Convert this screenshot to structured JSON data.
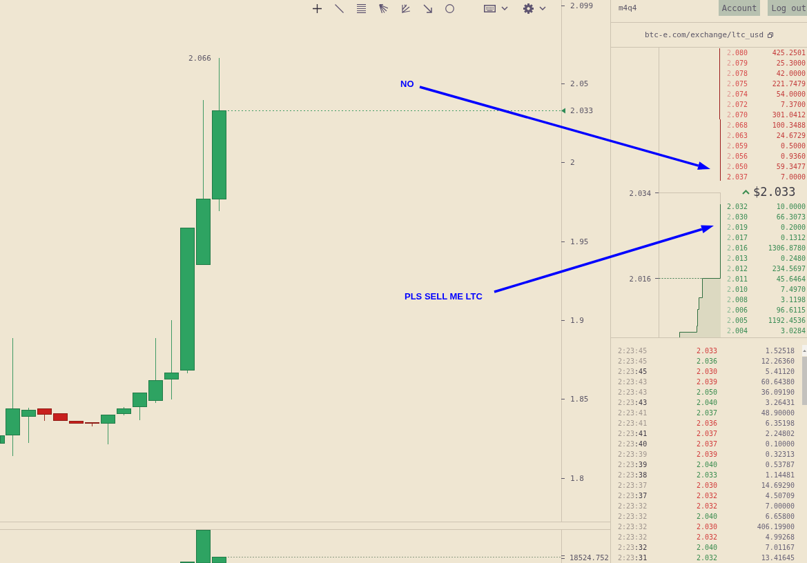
{
  "price_chart": {
    "high_label": "2.066",
    "axis_labels": [
      "2.099",
      "2.05",
      "2",
      "1.95",
      "1.9",
      "1.85",
      "1.8"
    ],
    "last_price_label": "2.033"
  },
  "volume_chart": {
    "axis_label": "18524.752"
  },
  "annotations": [
    {
      "text": "NO"
    },
    {
      "text": "PLS SELL ME LTC"
    }
  ],
  "header": {
    "username": "m4q4",
    "buttons": [
      "Account",
      "Log out"
    ]
  },
  "market_link": "btc-e.com/exchange/ltc_usd",
  "depth_chart": {
    "axis_labels": [
      "2.034",
      "2.016"
    ]
  },
  "asks": [
    {
      "price": "2.080",
      "amount": "425.2501",
      "best": false
    },
    {
      "price": "2.079",
      "amount": "25.3000",
      "best": false
    },
    {
      "price": "2.078",
      "amount": "42.0000",
      "best": false
    },
    {
      "price": "2.075",
      "amount": "221.7479",
      "best": false
    },
    {
      "price": "2.074",
      "amount": "54.0000",
      "best": false
    },
    {
      "price": "2.072",
      "amount": "7.3700",
      "best": false
    },
    {
      "price": "2.070",
      "amount": "301.0412",
      "best": false
    },
    {
      "price": "2.068",
      "amount": "100.3488",
      "best": false
    },
    {
      "price": "2.063",
      "amount": "24.6729",
      "best": false
    },
    {
      "price": "2.059",
      "amount": "0.5000",
      "best": false
    },
    {
      "price": "2.056",
      "amount": "0.9360",
      "best": false
    },
    {
      "price": "2.050",
      "amount": "59.3477",
      "best": false
    },
    {
      "price": "2.037",
      "amount": "7.0000",
      "best": true
    }
  ],
  "last_price": {
    "value": "$2.033",
    "rising": true
  },
  "bids": [
    {
      "price": "2.032",
      "amount": "10.0000",
      "best": true
    },
    {
      "price": "2.030",
      "amount": "66.3073",
      "best": false
    },
    {
      "price": "2.019",
      "amount": "0.2000",
      "best": false
    },
    {
      "price": "2.017",
      "amount": "0.1312",
      "best": false
    },
    {
      "price": "2.016",
      "amount": "1306.8780",
      "best": false
    },
    {
      "price": "2.013",
      "amount": "0.2480",
      "best": false
    },
    {
      "price": "2.012",
      "amount": "234.5697",
      "best": false
    },
    {
      "price": "2.011",
      "amount": "45.6464",
      "best": false
    },
    {
      "price": "2.010",
      "amount": "7.4970",
      "best": false
    },
    {
      "price": "2.008",
      "amount": "3.1198",
      "best": false
    },
    {
      "price": "2.006",
      "amount": "96.6115",
      "best": false
    },
    {
      "price": "2.005",
      "amount": "1192.4536",
      "best": false
    },
    {
      "price": "2.004",
      "amount": "3.0284",
      "best": false
    }
  ],
  "trades": [
    {
      "time": "2:23:45",
      "seconds_highlighted": false,
      "price": "2.033",
      "color": "#d23c3c",
      "amount": "1.52518"
    },
    {
      "time": "2:23:45",
      "seconds_highlighted": false,
      "price": "2.036",
      "color": "#3a8c4f",
      "amount": "12.26360"
    },
    {
      "time": "2:23:45",
      "seconds_highlighted": true,
      "price": "2.030",
      "color": "#d23c3c",
      "amount": "5.41120"
    },
    {
      "time": "2:23:43",
      "seconds_highlighted": false,
      "price": "2.039",
      "color": "#d23c3c",
      "amount": "60.64380"
    },
    {
      "time": "2:23:43",
      "seconds_highlighted": false,
      "price": "2.050",
      "color": "#3a8c4f",
      "amount": "36.09190"
    },
    {
      "time": "2:23:43",
      "seconds_highlighted": true,
      "price": "2.040",
      "color": "#3a8c4f",
      "amount": "3.26431"
    },
    {
      "time": "2:23:41",
      "seconds_highlighted": false,
      "price": "2.037",
      "color": "#3a8c4f",
      "amount": "48.90000"
    },
    {
      "time": "2:23:41",
      "seconds_highlighted": false,
      "price": "2.036",
      "color": "#d23c3c",
      "amount": "6.35198"
    },
    {
      "time": "2:23:41",
      "seconds_highlighted": true,
      "price": "2.037",
      "color": "#d23c3c",
      "amount": "2.24802"
    },
    {
      "time": "2:23:40",
      "seconds_highlighted": true,
      "price": "2.037",
      "color": "#d23c3c",
      "amount": "0.10000"
    },
    {
      "time": "2:23:39",
      "seconds_highlighted": false,
      "price": "2.039",
      "color": "#d23c3c",
      "amount": "0.32313"
    },
    {
      "time": "2:23:39",
      "seconds_highlighted": true,
      "price": "2.040",
      "color": "#3a8c4f",
      "amount": "0.53787"
    },
    {
      "time": "2:23:38",
      "seconds_highlighted": true,
      "price": "2.033",
      "color": "#3a8c4f",
      "amount": "1.14481"
    },
    {
      "time": "2:23:37",
      "seconds_highlighted": false,
      "price": "2.030",
      "color": "#d23c3c",
      "amount": "14.69290"
    },
    {
      "time": "2:23:37",
      "seconds_highlighted": true,
      "price": "2.032",
      "color": "#d23c3c",
      "amount": "4.50709"
    },
    {
      "time": "2:23:32",
      "seconds_highlighted": false,
      "price": "2.032",
      "color": "#d23c3c",
      "amount": "7.00000"
    },
    {
      "time": "2:23:32",
      "seconds_highlighted": false,
      "price": "2.040",
      "color": "#3a8c4f",
      "amount": "6.65800"
    },
    {
      "time": "2:23:32",
      "seconds_highlighted": false,
      "price": "2.030",
      "color": "#d23c3c",
      "amount": "406.19900"
    },
    {
      "time": "2:23:32",
      "seconds_highlighted": false,
      "price": "2.032",
      "color": "#d23c3c",
      "amount": "4.99268"
    },
    {
      "time": "2:23:32",
      "seconds_highlighted": true,
      "price": "2.040",
      "color": "#3a8c4f",
      "amount": "7.01167"
    },
    {
      "time": "2:23:31",
      "seconds_highlighted": true,
      "price": "2.032",
      "color": "#3a8c4f",
      "amount": "13.41645"
    }
  ]
}
